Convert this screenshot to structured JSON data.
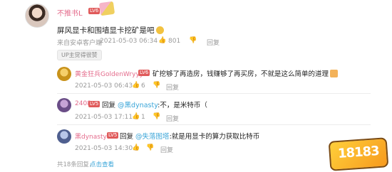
{
  "main_comment": {
    "username": "不推书L",
    "level": "LV6",
    "text": "屏风显卡和围墙显卡挖矿是吧",
    "location": "来自安卓客户端",
    "time": "2021-05-03 06:34",
    "likes": "801",
    "reply_label": "回复",
    "up_badge": "UP主觉得很赞"
  },
  "replies": [
    {
      "username": "黄金狂兵GoldenWryyy",
      "level": "LV6",
      "text": "矿挖够了再造房，钱赚够了再买房，不就是这么简单的道理",
      "time": "2021-05-03 06:43",
      "likes": "6",
      "reply_label": "回复"
    },
    {
      "username": "2408",
      "level": "LV5",
      "reply_prefix": "回复",
      "mention": "@黑dynasty",
      "text": ":不，是米特币（",
      "time": "2021-05-03 17:11",
      "likes": "1",
      "reply_label": "回复"
    },
    {
      "username": "黑dynasty",
      "level": "LV5",
      "reply_prefix": "回复",
      "mention": "@失落图塔",
      "text": ":就是用显卡的算力获取比特币",
      "time": "2021-05-03 14:30",
      "likes": "",
      "reply_label": "回复"
    }
  ],
  "footer": {
    "total": "共18条回复，",
    "view_more": "点击查看"
  },
  "watermark": "18183"
}
